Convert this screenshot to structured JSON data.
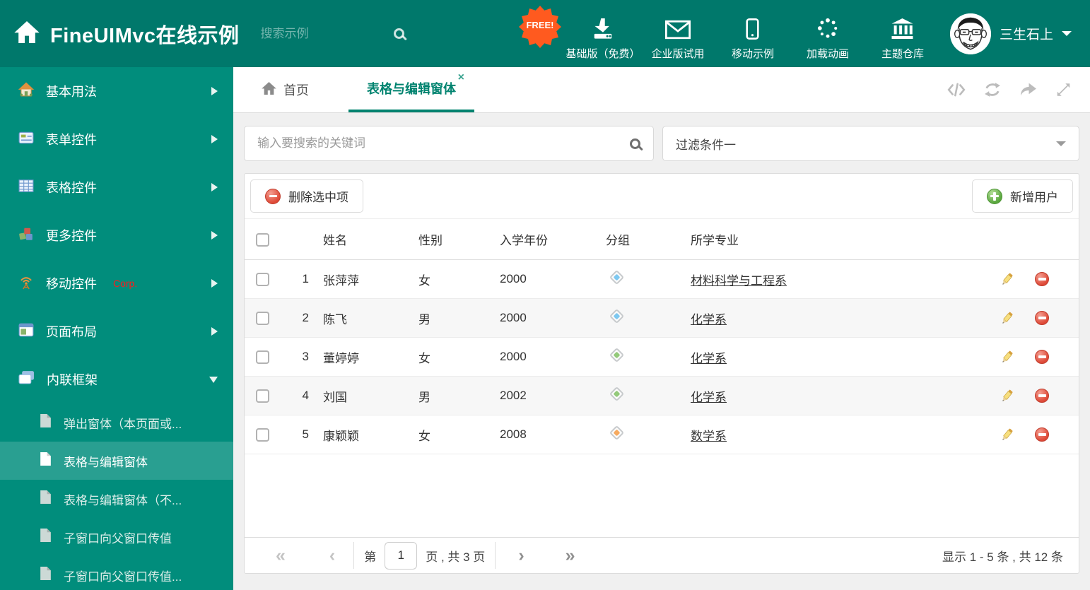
{
  "colors": {
    "header_bg": "#00786b",
    "sidebar_bg": "#018d7c",
    "accent": "#00836f",
    "free_badge": "#ff5a1f",
    "corp_red": "#ff1a1a",
    "tag_blue": "#7ec8f0",
    "tag_green": "#93c97a",
    "tag_orange": "#f6aa60"
  },
  "header": {
    "title": "FineUIMvc在线示例",
    "search_placeholder": "搜索示例",
    "menu": [
      {
        "label": "基础版（免费）",
        "icon": "download-icon",
        "badge": "FREE!"
      },
      {
        "label": "企业版试用",
        "icon": "envelope-icon"
      },
      {
        "label": "移动示例",
        "icon": "mobile-icon"
      },
      {
        "label": "加载动画",
        "icon": "spinner-icon"
      },
      {
        "label": "主题仓库",
        "icon": "bank-icon"
      }
    ],
    "user_name": "三生石上"
  },
  "sidebar": {
    "items": [
      {
        "label": "基本用法"
      },
      {
        "label": "表单控件"
      },
      {
        "label": "表格控件"
      },
      {
        "label": "更多控件"
      },
      {
        "label": "移动控件",
        "badge": "Corp."
      },
      {
        "label": "页面布局"
      },
      {
        "label": "内联框架"
      }
    ],
    "subitems": [
      {
        "label": "弹出窗体（本页面或..."
      },
      {
        "label": "表格与编辑窗体"
      },
      {
        "label": "表格与编辑窗体（不..."
      },
      {
        "label": "子窗口向父窗口传值"
      },
      {
        "label": "子窗口向父窗口传值..."
      }
    ]
  },
  "tabs": {
    "home_label": "首页",
    "active_label": "表格与编辑窗体",
    "close_glyph": "×"
  },
  "filter": {
    "search_placeholder": "输入要搜索的关键词",
    "dropdown_value": "过滤条件一"
  },
  "toolbar": {
    "delete_label": "删除选中项",
    "add_label": "新增用户"
  },
  "table": {
    "headers": {
      "name": "姓名",
      "gender": "性别",
      "year": "入学年份",
      "group": "分组",
      "major": "所学专业"
    },
    "rows": [
      {
        "num": "1",
        "name": "张萍萍",
        "gender": "女",
        "year": "2000",
        "tag": "#7ec8f0",
        "major": "材料科学与工程系"
      },
      {
        "num": "2",
        "name": "陈飞",
        "gender": "男",
        "year": "2000",
        "tag": "#7ec8f0",
        "major": "化学系"
      },
      {
        "num": "3",
        "name": "董婷婷",
        "gender": "女",
        "year": "2000",
        "tag": "#93c97a",
        "major": "化学系"
      },
      {
        "num": "4",
        "name": "刘国",
        "gender": "男",
        "year": "2002",
        "tag": "#93c97a",
        "major": "化学系"
      },
      {
        "num": "5",
        "name": "康颖颖",
        "gender": "女",
        "year": "2008",
        "tag": "#f6aa60",
        "major": "数学系"
      }
    ]
  },
  "pagination": {
    "first_glyph": "«",
    "prev_glyph": "‹",
    "next_glyph": "›",
    "last_glyph": "»",
    "page_prefix": "第",
    "page_value": "1",
    "page_suffix": "页 , 共 3 页",
    "summary": "显示 1 - 5 条 , 共 12 条"
  }
}
